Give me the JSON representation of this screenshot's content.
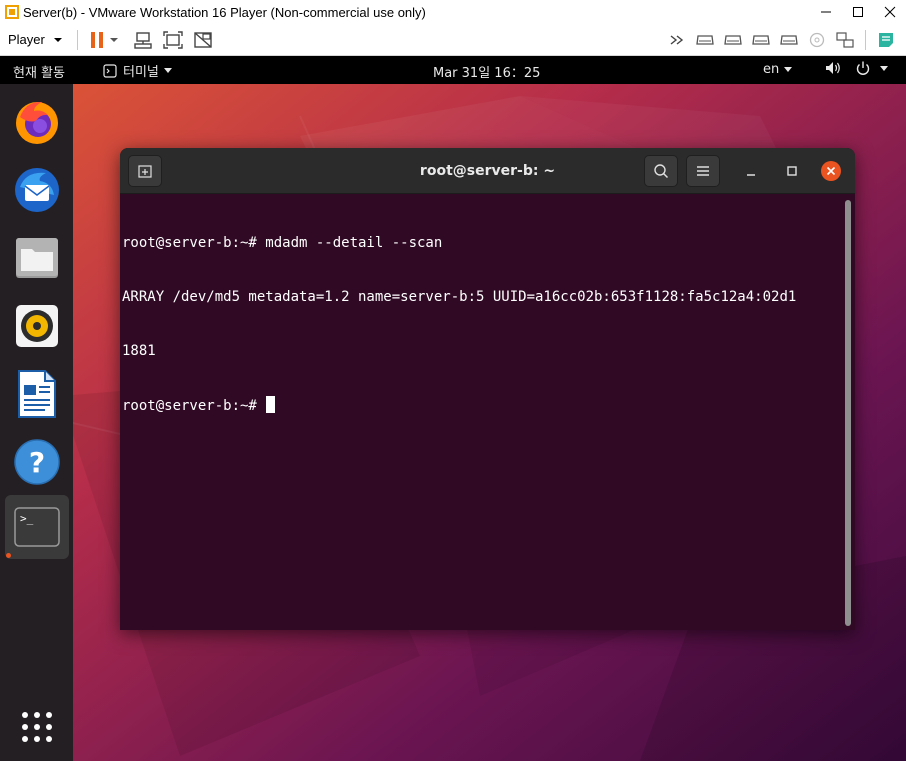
{
  "vmware": {
    "window_title": "Server(b) - VMware Workstation 16 Player (Non-commercial use only)",
    "player_menu_label": "Player",
    "toolbar_icons": [
      "pause-icon",
      "send-ctrl-alt-del-icon",
      "fit-guest-icon",
      "unity-icon"
    ],
    "device_icons": [
      "more-devices-icon",
      "hard-disk-icon",
      "hard-disk-icon",
      "hard-disk-icon",
      "hard-disk-icon",
      "cd-icon",
      "network-icon",
      "message-log-icon"
    ]
  },
  "topbar": {
    "activities": "현재 활동",
    "app_menu": "터미널",
    "clock": "Mar 31일  16：25",
    "input_language": "en"
  },
  "dock": {
    "items": [
      "Firefox",
      "Thunderbird",
      "Files",
      "Rhythmbox",
      "LibreOffice Writer",
      "Help",
      "Terminal"
    ]
  },
  "terminal": {
    "title": "root@server-b: ~",
    "lines": [
      "root@server-b:~# mdadm --detail --scan",
      "ARRAY /dev/md5 metadata=1.2 name=server-b:5 UUID=a16cc02b:653f1128:fa5c12a4:02d1",
      "1881",
      "root@server-b:~# "
    ]
  },
  "colors": {
    "terminal_bg": "#300a24",
    "ubuntu_orange": "#e95420",
    "topbar_bg": "#000000",
    "dock_bg": "#241f23"
  }
}
